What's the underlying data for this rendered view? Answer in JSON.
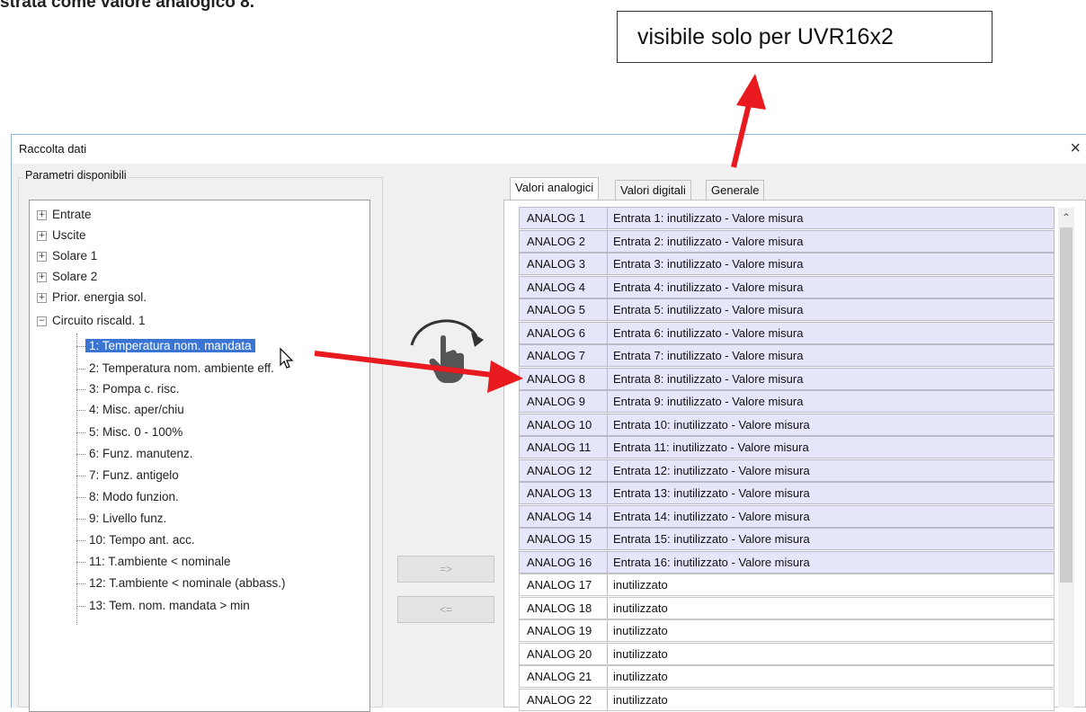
{
  "document": {
    "top_text": "strata come valore analogico 8."
  },
  "callout": {
    "text": "visibile solo per UVR16x2"
  },
  "dialog": {
    "title": "Raccolta dati",
    "close_glyph": "×"
  },
  "left_panel": {
    "group_title": "Parametri disponibili",
    "tree": [
      {
        "label": "Entrate",
        "expander": "+"
      },
      {
        "label": "Uscite",
        "expander": "+"
      },
      {
        "label": "Solare 1",
        "expander": "+"
      },
      {
        "label": "Solare 2",
        "expander": "+"
      },
      {
        "label": "Prior. energia sol.",
        "expander": "+"
      },
      {
        "label": "Circuito riscald. 1",
        "expander": "−"
      }
    ],
    "children": [
      "1: Temperatura nom. mandata",
      "2: Temperatura nom. ambiente eff.",
      "3: Pompa c. risc.",
      "4: Misc. aper/chiu",
      "5: Misc. 0 - 100%",
      "6: Funz. manutenz.",
      "7: Funz. antigelo",
      "8: Modo funzion.",
      "9: Livello funz.",
      "10: Tempo ant. acc.",
      "11: T.ambiente < nominale",
      "12: T.ambiente < nominale (abbass.)",
      "13: Tem. nom. mandata > min"
    ],
    "selected_child": "1: Temperatura nom. mandata"
  },
  "buttons": {
    "add": "=>",
    "remove": "<="
  },
  "tabs": [
    "Valori analogici",
    "Valori digitali",
    "Generale"
  ],
  "active_tab": "Valori analogici",
  "analog_rows": [
    {
      "name": "ANALOG 1",
      "value": "Entrata 1: inutilizzato - Valore misura",
      "used": true
    },
    {
      "name": "ANALOG 2",
      "value": "Entrata 2: inutilizzato - Valore misura",
      "used": true
    },
    {
      "name": "ANALOG 3",
      "value": "Entrata 3: inutilizzato - Valore misura",
      "used": true
    },
    {
      "name": "ANALOG 4",
      "value": "Entrata 4: inutilizzato - Valore misura",
      "used": true
    },
    {
      "name": "ANALOG 5",
      "value": "Entrata 5: inutilizzato - Valore misura",
      "used": true
    },
    {
      "name": "ANALOG 6",
      "value": "Entrata 6: inutilizzato - Valore misura",
      "used": true
    },
    {
      "name": "ANALOG 7",
      "value": "Entrata 7: inutilizzato - Valore misura",
      "used": true
    },
    {
      "name": "ANALOG 8",
      "value": "Entrata 8: inutilizzato - Valore misura",
      "used": true
    },
    {
      "name": "ANALOG 9",
      "value": "Entrata 9: inutilizzato - Valore misura",
      "used": true
    },
    {
      "name": "ANALOG 10",
      "value": "Entrata 10: inutilizzato - Valore misura",
      "used": true
    },
    {
      "name": "ANALOG 11",
      "value": "Entrata 11: inutilizzato - Valore misura",
      "used": true
    },
    {
      "name": "ANALOG 12",
      "value": "Entrata 12: inutilizzato - Valore misura",
      "used": true
    },
    {
      "name": "ANALOG 13",
      "value": "Entrata 13: inutilizzato - Valore misura",
      "used": true
    },
    {
      "name": "ANALOG 14",
      "value": "Entrata 14: inutilizzato - Valore misura",
      "used": true
    },
    {
      "name": "ANALOG 15",
      "value": "Entrata 15: inutilizzato - Valore misura",
      "used": true
    },
    {
      "name": "ANALOG 16",
      "value": "Entrata 16: inutilizzato - Valore misura",
      "used": true
    },
    {
      "name": "ANALOG 17",
      "value": "inutilizzato",
      "used": false
    },
    {
      "name": "ANALOG 18",
      "value": "inutilizzato",
      "used": false
    },
    {
      "name": "ANALOG 19",
      "value": "inutilizzato",
      "used": false
    },
    {
      "name": "ANALOG 20",
      "value": "inutilizzato",
      "used": false
    },
    {
      "name": "ANALOG 21",
      "value": "inutilizzato",
      "used": false
    },
    {
      "name": "ANALOG 22",
      "value": "inutilizzato",
      "used": false
    }
  ],
  "colors": {
    "arrow": "#e8191f",
    "selection": "#3a75d3",
    "used_row": "#e6e6fa"
  }
}
